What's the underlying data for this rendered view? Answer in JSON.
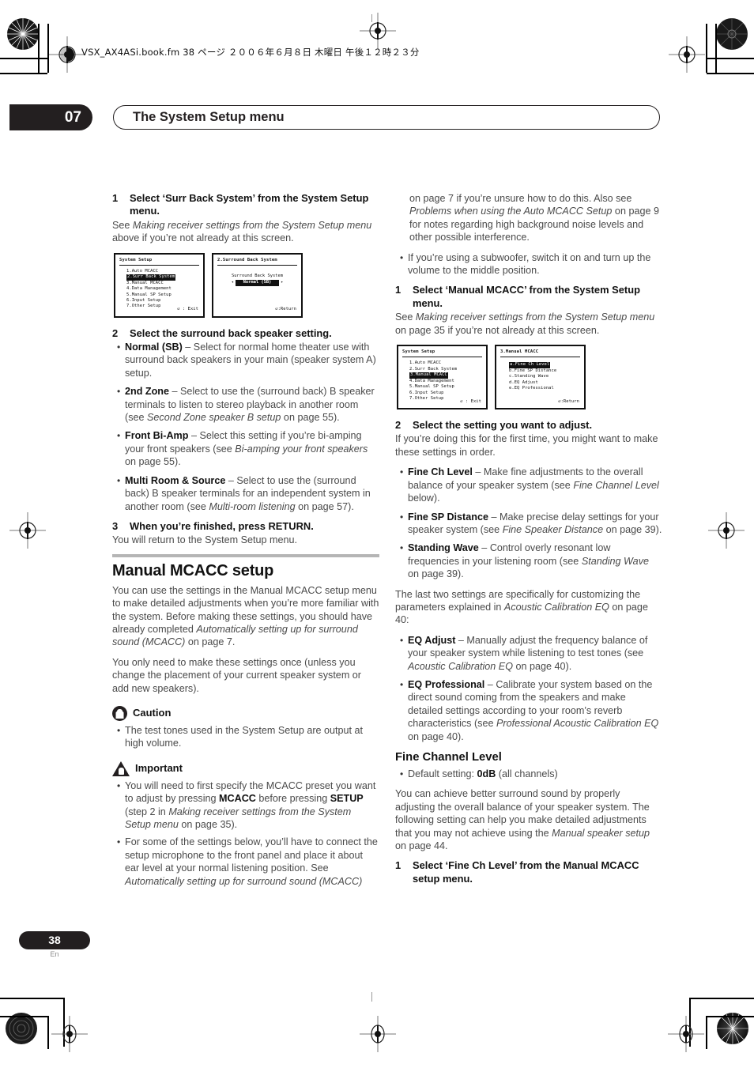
{
  "file_header": "VSX_AX4ASi.book.fm 38 ページ ２００６年６月８日  木曜日  午後１２時２３分",
  "chapter": {
    "number": "07",
    "title": "The System Setup menu"
  },
  "footer": {
    "page": "38",
    "language": "En"
  },
  "left_column": {
    "step1": {
      "num": "1",
      "text": "Select ‘Surr Back System’ from the System Setup menu."
    },
    "step1_body_a": "See ",
    "step1_body_i": "Making receiver settings from the System Setup menu",
    "step1_body_b": " above if you’re not already at this screen.",
    "osd1": {
      "title": "System Setup",
      "items": [
        "1.Auto  MCACC",
        "2.Surr  Back  System",
        "3.Manual  MCACC",
        "4.Data  Management",
        "5.Manual  SP  Setup",
        "6.Input  Setup",
        "7.Other  Setup"
      ],
      "selected_index": 1,
      "footer": "↺ : Exit"
    },
    "osd2": {
      "title": "2.Surround  Back  System",
      "label": "Surround Back System",
      "value": "Normal (SB)",
      "footer": "↺:Return"
    },
    "step2": {
      "num": "2",
      "text": "Select the surround back speaker setting."
    },
    "bullets": [
      {
        "term": "Normal (SB)",
        "dash": " – ",
        "text_a": "Select for normal home theater use with surround back speakers in your main (speaker system A) setup."
      },
      {
        "term": "2nd Zone",
        "dash": " – ",
        "text_a": "Select to use the (surround back) B speaker terminals to listen to stereo playback in another room (see ",
        "italic": "Second Zone speaker B setup",
        "text_b": " on page 55)."
      },
      {
        "term": "Front Bi-Amp",
        "dash": " – ",
        "text_a": "Select this setting if you’re bi-amping your front speakers (see ",
        "italic": "Bi-amping your front speakers",
        "text_b": " on page 55)."
      },
      {
        "term": "Multi Room & Source",
        "dash": " – ",
        "text_a": "Select to use the (surround back) B speaker terminals for an independent system in another room (see ",
        "italic": "Multi-room listening",
        "text_b": " on page 57)."
      }
    ],
    "step3": {
      "num": "3",
      "text": "When you’re finished, press RETURN."
    },
    "step3_body": "You will return to the System Setup menu.",
    "section_title": "Manual MCACC setup",
    "section_p1_a": "You can use the settings in the Manual MCACC setup menu to make detailed adjustments when you’re more familiar with the system. Before making these settings, you should have already completed ",
    "section_p1_i": "Automatically setting up for surround sound (MCACC)",
    "section_p1_b": " on page 7.",
    "section_p2": "You only need to make these settings once (unless you change the placement of your current speaker system or add new speakers).",
    "caution": {
      "label": "Caution",
      "bullets": [
        "The test tones used in the System Setup are output at high volume."
      ]
    },
    "important": {
      "label": "Important",
      "bullet1_a": "You will need to first specify the MCACC preset you want to adjust by pressing ",
      "bullet1_b1": "MCACC",
      "bullet1_c": " before pressing ",
      "bullet1_b2": "SETUP",
      "bullet1_d": " (step 2 in ",
      "bullet1_i": "Making receiver settings from the System Setup menu",
      "bullet1_e": " on page 35).",
      "bullet2_a": "For some of the settings below, you’ll have to connect the setup microphone to the front panel and place it about ear level at your normal listening position. See ",
      "bullet2_i": "Automatically setting up for surround sound (MCACC)"
    }
  },
  "right_column": {
    "cont_a": "on page 7 if you’re unsure how to do this. Also see ",
    "cont_i": "Problems when using the Auto MCACC Setup",
    "cont_b": " on page 9 for notes regarding high background noise levels and other possible interference.",
    "bullet_sub": "If you’re using a subwoofer, switch it on and turn up the volume to the middle position.",
    "step1": {
      "num": "1",
      "text": "Select ‘Manual MCACC’ from the System Setup menu."
    },
    "step1_body_a": "See ",
    "step1_body_i": "Making receiver settings from the System Setup menu",
    "step1_body_b": " on page 35 if you’re not already at this screen.",
    "osd1": {
      "title": "System Setup",
      "items": [
        "1.Auto  MCACC",
        "2.Surr  Back  System",
        "3.Manual  MCACC",
        "4.Data  Management",
        "5.Manual  SP  Setup",
        "6.Input  Setup",
        "7.Other  Setup"
      ],
      "selected_index": 2,
      "footer": "↺ : Exit"
    },
    "osd2": {
      "title": "3.Manual  MCACC",
      "items": [
        "a.Fine  Ch  Level",
        "b.Fine  SP  Distance",
        "c.Standing  Wave",
        "d.EQ  Adjust",
        "e.EQ  Professional"
      ],
      "selected_index": 0,
      "footer": "↺:Return"
    },
    "step2": {
      "num": "2",
      "text": "Select the setting you want to adjust."
    },
    "step2_body": "If you’re doing this for the first time, you might want to make these settings in order.",
    "bullets1": [
      {
        "term": "Fine Ch Level",
        "dash": " – ",
        "text_a": "Make fine adjustments to the overall balance of your speaker system (see ",
        "italic": "Fine Channel Level",
        "text_b": " below)."
      },
      {
        "term": "Fine SP Distance",
        "dash": " – ",
        "text_a": "Make precise delay settings for your speaker system (see ",
        "italic": "Fine Speaker Distance",
        "text_b": " on page 39)."
      },
      {
        "term": "Standing Wave",
        "dash": " – ",
        "text_a": "Control overly resonant low frequencies in your listening room (see ",
        "italic": "Standing Wave",
        "text_b": " on page 39)."
      }
    ],
    "mid_p_a": "The last two settings are specifically for customizing the parameters explained in ",
    "mid_p_i": "Acoustic Calibration EQ",
    "mid_p_b": " on page 40:",
    "bullets2": [
      {
        "term": "EQ Adjust",
        "dash": " – ",
        "text_a": "Manually adjust the frequency balance of your speaker system while listening to test tones (see ",
        "italic": "Acoustic Calibration EQ",
        "text_b": " on page 40)."
      },
      {
        "term": "EQ Professional",
        "dash": " – ",
        "text_a": "Calibrate your system based on the direct sound coming from the speakers and make detailed settings according to your room’s reverb characteristics (see ",
        "italic": "Professional Acoustic Calibration EQ",
        "text_b": " on page 40)."
      }
    ],
    "sub_title": "Fine Channel Level",
    "default_a": "Default setting: ",
    "default_b": "0dB",
    "default_c": " (all channels)",
    "p_a": "You can achieve better surround sound by properly adjusting the overall balance of your speaker system. The following setting can help you make detailed adjustments that you may not achieve using the ",
    "p_i": "Manual speaker setup",
    "p_b": " on page 44.",
    "last_step": {
      "num": "1",
      "text": "Select ‘Fine Ch Level’ from the Manual MCACC setup menu."
    }
  }
}
